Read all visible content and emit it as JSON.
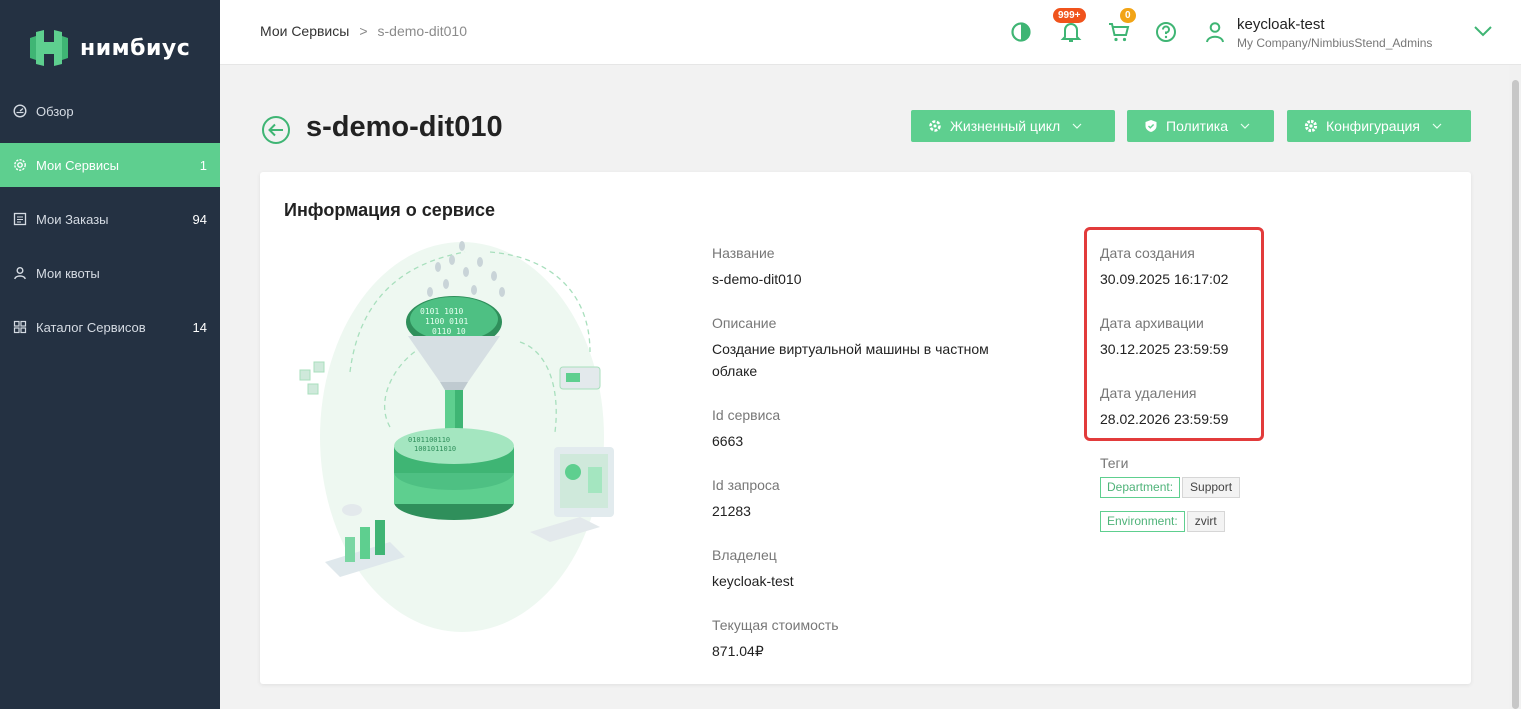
{
  "app": {
    "logo_text": "нимбиус"
  },
  "sidebar": {
    "items": [
      {
        "label": "Обзор",
        "count": "",
        "icon": "dashboard-icon"
      },
      {
        "label": "Мои Сервисы",
        "count": "1",
        "icon": "gear-icon",
        "active": true
      },
      {
        "label": "Мои Заказы",
        "count": "94",
        "icon": "orders-icon"
      },
      {
        "label": "Мои квоты",
        "count": "",
        "icon": "user-icon"
      },
      {
        "label": "Каталог Сервисов",
        "count": "14",
        "icon": "grid-icon"
      }
    ]
  },
  "header": {
    "breadcrumb": {
      "parent": "Мои Сервисы",
      "separator": ">",
      "current": "s-demo-dit010"
    },
    "notifications_badge": "999+",
    "cart_badge": "0",
    "user": {
      "name": "keycloak-test",
      "org": "My Company/NimbiusStend_Admins"
    }
  },
  "page": {
    "title": "s-demo-dit010",
    "actions": {
      "lifecycle": "Жизненный цикл",
      "policy": "Политика",
      "configuration": "Конфигурация"
    }
  },
  "service_info": {
    "title": "Информация о сервисе",
    "name": {
      "label": "Название",
      "value": "s-demo-dit010"
    },
    "description": {
      "label": "Описание",
      "value": "Создание виртуальной машины в частном облаке"
    },
    "service_id": {
      "label": "Id сервиса",
      "value": "6663"
    },
    "request_id": {
      "label": "Id запроса",
      "value": "21283"
    },
    "owner": {
      "label": "Владелец",
      "value": "keycloak-test"
    },
    "cost": {
      "label": "Текущая стоимость",
      "value": "871.04₽"
    },
    "created": {
      "label": "Дата создания",
      "value": "30.09.2025 16:17:02"
    },
    "archived": {
      "label": "Дата архивации",
      "value": "30.12.2025 23:59:59"
    },
    "deleted": {
      "label": "Дата удаления",
      "value": "28.02.2026 23:59:59"
    },
    "tags_label": "Теги",
    "tags": [
      {
        "key": "Department:",
        "value": "Support"
      },
      {
        "key": "Environment:",
        "value": "zvirt"
      }
    ]
  },
  "colors": {
    "accent": "#5ecf8f",
    "sidebar": "#243142",
    "highlight": "#e23b3b"
  }
}
